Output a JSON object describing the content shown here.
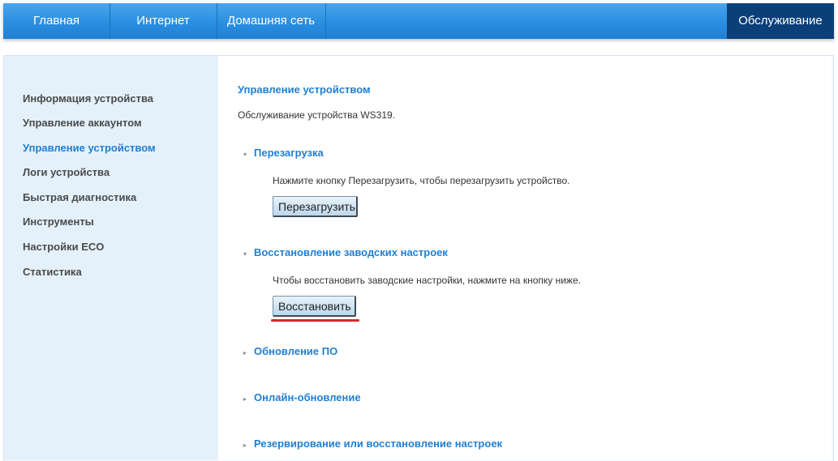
{
  "nav": {
    "tabs": [
      {
        "label": "Главная"
      },
      {
        "label": "Интернет"
      },
      {
        "label": "Домашняя сеть"
      },
      {
        "label": "Обслуживание"
      }
    ]
  },
  "sidebar": {
    "items": [
      {
        "label": "Информация устройства"
      },
      {
        "label": "Управление аккаунтом"
      },
      {
        "label": "Управление устройством"
      },
      {
        "label": "Логи устройства"
      },
      {
        "label": "Быстрая диагностика"
      },
      {
        "label": "Инструменты"
      },
      {
        "label": "Настройки ECO"
      },
      {
        "label": "Статистика"
      }
    ]
  },
  "main": {
    "title": "Управление устройством",
    "description": "Обслуживание устройства WS319.",
    "sections": {
      "reboot": {
        "title": "Перезагрузка",
        "text": "Нажмите кнопку Перезагрузить, чтобы перезагрузить устройство.",
        "button": "Перезагрузить"
      },
      "factory": {
        "title": "Восстановление заводских настроек",
        "text": "Чтобы восстановить заводские настройки, нажмите на кнопку ниже.",
        "button": "Восстановить"
      },
      "firmware": {
        "title": "Обновление ПО"
      },
      "online": {
        "title": "Онлайн-обновление"
      },
      "backup": {
        "title": "Резервирование или восстановление настроек"
      }
    }
  },
  "icons": {
    "expanded": "▾",
    "collapsed": "▸"
  },
  "colors": {
    "nav_blue": "#2b8ee0",
    "nav_active": "#0b3f78",
    "link_blue": "#1f7fd3",
    "highlight_red": "#d8262e"
  }
}
